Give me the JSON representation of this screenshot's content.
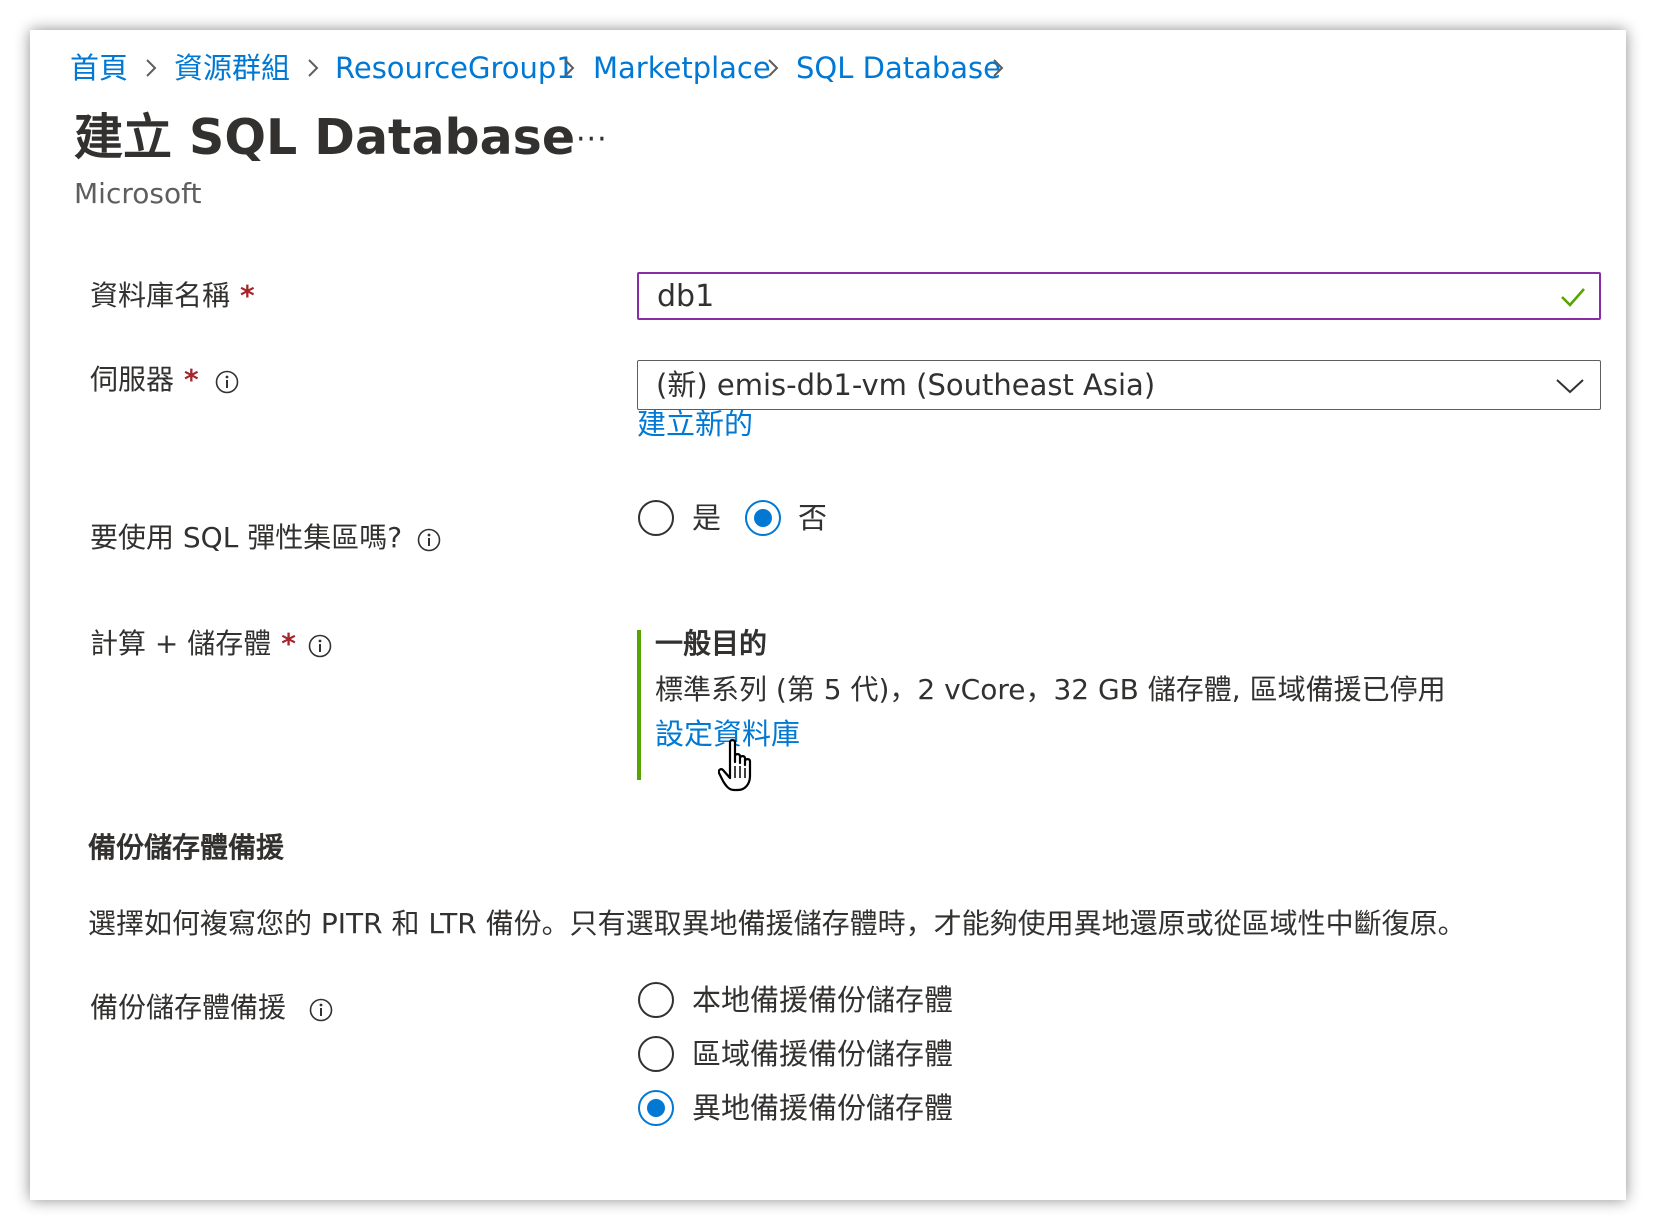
{
  "breadcrumb": [
    {
      "label": "首頁"
    },
    {
      "label": "資源群組"
    },
    {
      "label": "ResourceGroup1"
    },
    {
      "label": "Marketplace"
    },
    {
      "label": "SQL Database"
    }
  ],
  "page": {
    "title": "建立 SQL Database",
    "more_label": "···",
    "publisher": "Microsoft"
  },
  "form": {
    "db_name": {
      "label": "資料庫名稱",
      "required": "*",
      "value": "db1"
    },
    "server": {
      "label": "伺服器",
      "required": "*",
      "value": "(新) emis-db1-vm (Southeast Asia)",
      "create_new_link": "建立新的"
    },
    "elastic_pool": {
      "label": "要使用 SQL 彈性集區嗎?",
      "options": [
        {
          "label": "是",
          "selected": false
        },
        {
          "label": "否",
          "selected": true
        }
      ]
    },
    "compute": {
      "label": "計算 + 儲存體",
      "required": "*",
      "tier": "一般目的",
      "details": "標準系列 (第 5 代)，2 vCore，32 GB 儲存體, 區域備援已停用",
      "configure_link": "設定資料庫"
    }
  },
  "backup": {
    "section_title": "備份儲存體備援",
    "description": "選擇如何複寫您的 PITR 和 LTR 備份。只有選取異地備援儲存體時，才能夠使用異地還原或從區域性中斷復原。",
    "label": "備份儲存體備援",
    "options": [
      {
        "label": "本地備援備份儲存體",
        "selected": false
      },
      {
        "label": "區域備援備份儲存體",
        "selected": false
      },
      {
        "label": "異地備援備份儲存體",
        "selected": true
      }
    ]
  },
  "colors": {
    "link": "#0078d4",
    "required": "#a4262c",
    "focus_border": "#8a2da5",
    "valid_check": "#57a300",
    "tier_bar": "#57a300",
    "radio_selected": "#0078d4"
  }
}
